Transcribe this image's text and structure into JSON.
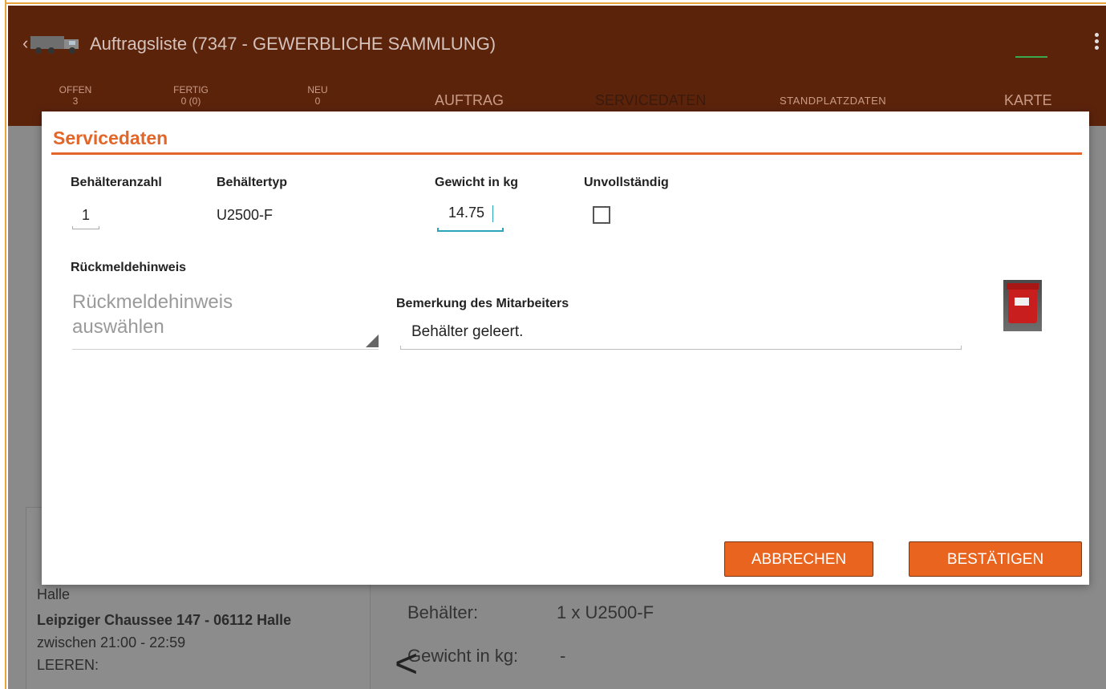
{
  "app": {
    "title": "Auftragsliste (7347 - GEWERBLICHE SAMMLUNG)",
    "tabs_left": [
      {
        "label": "OFFEN",
        "count": "3"
      },
      {
        "label": "FERTIG",
        "count": "0 (0)"
      },
      {
        "label": "NEU",
        "count": "0"
      }
    ],
    "tabs_right": [
      {
        "label": "AUFTRAG",
        "active": false
      },
      {
        "label": "SERVICEDATEN",
        "active": true
      },
      {
        "label": "STANDPLATZDATEN",
        "active": false
      },
      {
        "label": "KARTE",
        "active": false
      }
    ],
    "order_card": {
      "city": "Halle",
      "address": "Leipziger Chaussee 147 - 06112 Halle",
      "time": "zwischen 21:00 - 22:59",
      "action": "LEEREN:"
    },
    "details": {
      "behaelter_label": "Behälter:",
      "behaelter_value": "1 x U2500-F",
      "gewicht_label": "Gewicht in kg:",
      "gewicht_value": "-"
    },
    "colors": {
      "appbar": "#5c230b",
      "accent": "#e2662a"
    }
  },
  "dialog": {
    "title": "Servicedaten",
    "labels": {
      "count": "Behälteranzahl",
      "type": "Behältertyp",
      "weight": "Gewicht in kg",
      "incomplete": "Unvollständig",
      "feedback": "Rückmeldehinweis",
      "remark": "Bemerkung des Mitarbeiters"
    },
    "values": {
      "count": "1",
      "type": "U2500-F",
      "weight": "14.75",
      "incomplete_checked": false,
      "feedback_placeholder": "Rückmeldehinweis auswählen",
      "remark": "Behälter geleert."
    },
    "buttons": {
      "cancel": "ABBRECHEN",
      "confirm": "BESTÄTIGEN"
    }
  }
}
